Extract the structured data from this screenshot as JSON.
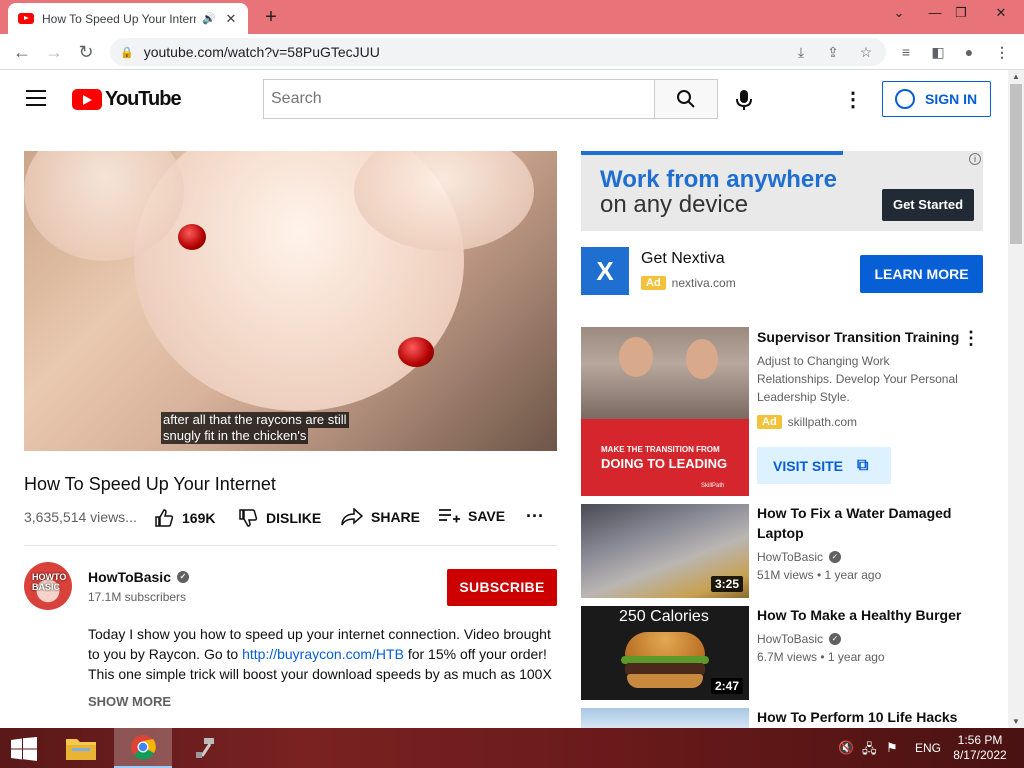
{
  "browser": {
    "tab_title": "How To Speed Up Your Internet",
    "url": "youtube.com/watch?v=58PuGTecJUU",
    "new_tab": "+",
    "win_min": "⌄",
    "win_minimize": "—",
    "win_restore": "❐",
    "win_close": "✕"
  },
  "header": {
    "logo_text": "YouTube",
    "search_placeholder": "Search",
    "sign_in": "SIGN IN"
  },
  "player": {
    "caption_line1": "after all that the raycons are still",
    "caption_line2": "snugly fit in the chicken's"
  },
  "video": {
    "title": "How To Speed Up Your Internet",
    "views": "3,635,514 views...",
    "likes": "169K",
    "dislike": "DISLIKE",
    "share": "SHARE",
    "save": "SAVE"
  },
  "channel": {
    "avatar_text": "HOWTO BASIC",
    "name": "HowToBasic",
    "subscribers": "17.1M subscribers",
    "subscribe": "SUBSCRIBE"
  },
  "description": {
    "text1": "Today I show you how to speed up your internet connection. Video brought to you by Raycon. Go to ",
    "link": "http://buyraycon.com/HTB",
    "text2": " for 15% off your order! This one simple trick will boost your download speeds by as much as 100X",
    "show_more": "SHOW MORE"
  },
  "ad": {
    "headline1": "Work from anywhere",
    "headline2": "on any device",
    "cta": "Get Started",
    "info": "i",
    "brand": "Get Nextiva",
    "badge": "Ad",
    "site": "nextiva.com",
    "learn_more": "LEARN MORE"
  },
  "promo": {
    "title": "Supervisor Transition Training",
    "description": "Adjust to Changing Work Relationships. Develop Your Personal Leadership Style.",
    "badge": "Ad",
    "site": "skillpath.com",
    "visit": "VISIT SITE",
    "thumb_line1": "MAKE THE TRANSITION FROM",
    "thumb_line2": "DOING TO LEADING",
    "thumb_brand": "SkillPath"
  },
  "recommendations": [
    {
      "title": "How To Fix a Water Damaged Laptop",
      "channel": "HowToBasic",
      "meta": "51M views • 1 year ago",
      "duration": "3:25"
    },
    {
      "title": "How To Make a Healthy Burger",
      "channel": "HowToBasic",
      "meta": "6.7M views • 1 year ago",
      "duration": "2:47",
      "thumb_text": "250 Calories"
    },
    {
      "title": "How To Perform 10 Life Hacks",
      "channel": "",
      "meta": "",
      "duration": ""
    }
  ],
  "taskbar": {
    "language": "ENG",
    "time": "1:56 PM",
    "date": "8/17/2022"
  },
  "colors": {
    "youtube_red": "#ff0000",
    "subscribe_red": "#cc0000",
    "link_blue": "#065fd4",
    "tab_bar": "#e8747a"
  }
}
